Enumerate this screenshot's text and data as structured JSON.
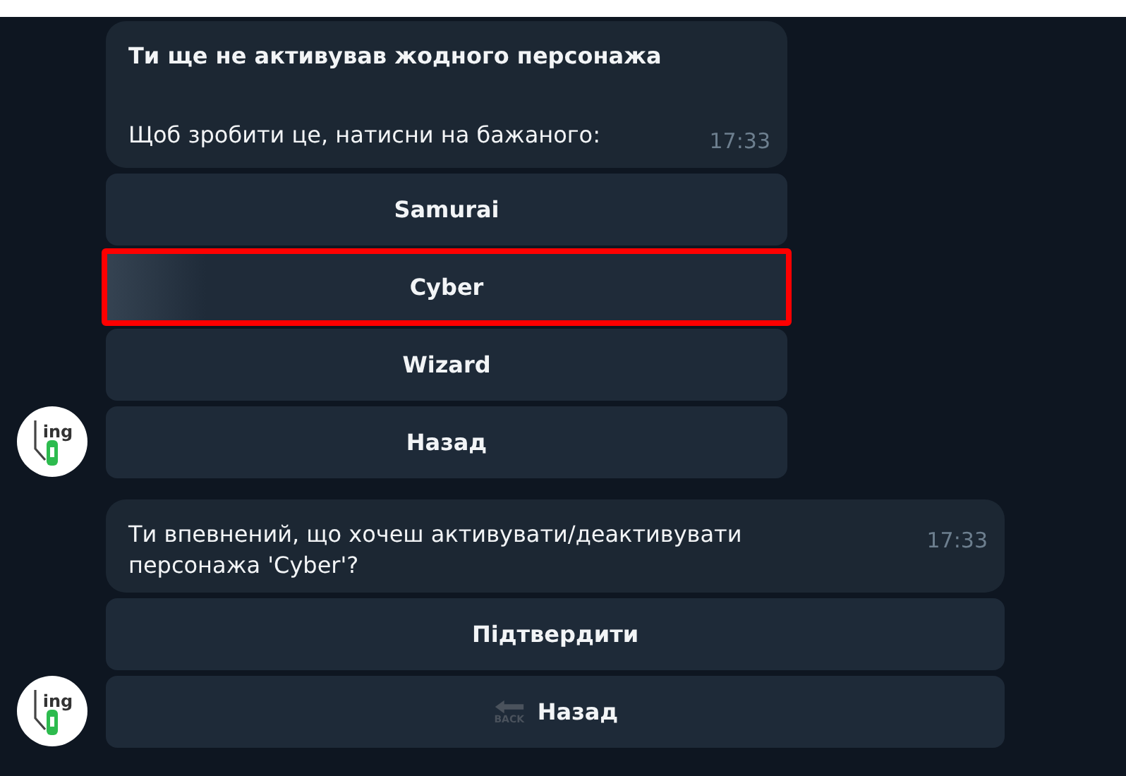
{
  "messages": [
    {
      "avatar": {
        "logo_text": "ing"
      },
      "paragraphs": [
        {
          "text": "Ти ще не активував жодного персонажа",
          "bold": true
        },
        {
          "text": "Щоб зробити це, натисни на бажаного:",
          "bold": false
        }
      ],
      "time": "17:33",
      "wide": false,
      "buttons": [
        {
          "label": "Samurai",
          "highlighted": false
        },
        {
          "label": "Cyber",
          "highlighted": true
        },
        {
          "label": "Wizard",
          "highlighted": false
        },
        {
          "label": "Назад",
          "highlighted": false
        }
      ]
    },
    {
      "avatar": {
        "logo_text": "ing"
      },
      "paragraphs": [
        {
          "text": "Ти впевнений, що хочеш активувати/деактивувати персонажа 'Cyber'?",
          "bold": false
        }
      ],
      "time": "17:33",
      "wide": true,
      "buttons": [
        {
          "label": "Підтвердити",
          "highlighted": false
        },
        {
          "label": "Назад",
          "highlighted": false,
          "icon": {
            "kind": "back",
            "label": "BACK"
          }
        }
      ]
    }
  ]
}
